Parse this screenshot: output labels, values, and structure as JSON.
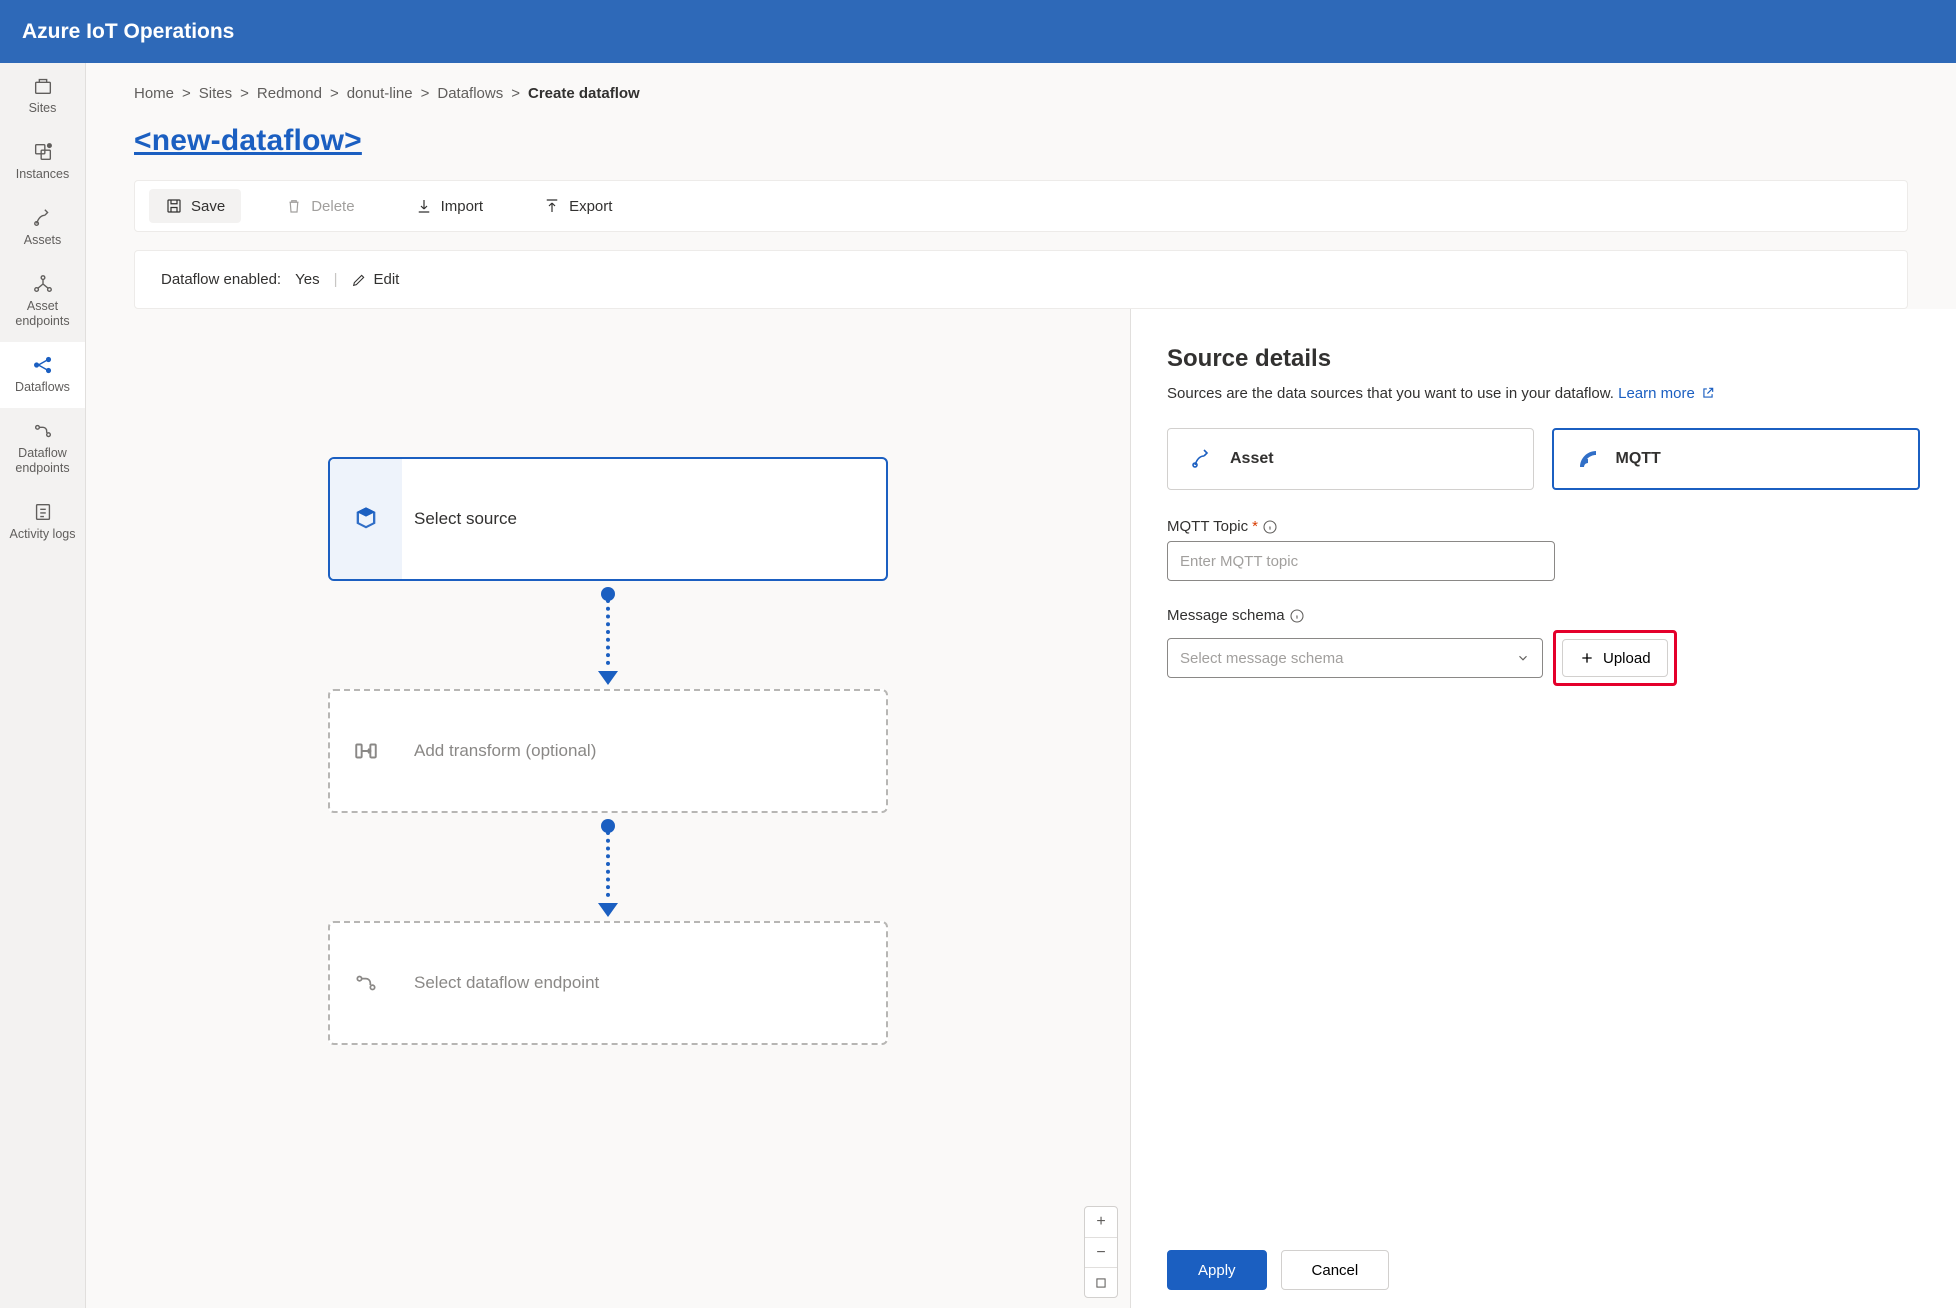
{
  "app": {
    "title": "Azure IoT Operations"
  },
  "sidebar": {
    "items": [
      {
        "label": "Sites"
      },
      {
        "label": "Instances"
      },
      {
        "label": "Assets"
      },
      {
        "label": "Asset endpoints"
      },
      {
        "label": "Dataflows"
      },
      {
        "label": "Dataflow endpoints"
      },
      {
        "label": "Activity logs"
      }
    ]
  },
  "breadcrumb": {
    "items": [
      "Home",
      "Sites",
      "Redmond",
      "donut-line",
      "Dataflows"
    ],
    "current": "Create dataflow"
  },
  "page": {
    "title": "<new-dataflow>"
  },
  "commands": {
    "save": "Save",
    "delete": "Delete",
    "import": "Import",
    "export": "Export"
  },
  "status": {
    "enabled_label": "Dataflow enabled:",
    "enabled_value": "Yes",
    "edit": "Edit"
  },
  "canvas": {
    "source": "Select source",
    "transform": "Add transform (optional)",
    "destination": "Select dataflow endpoint"
  },
  "details": {
    "title": "Source details",
    "desc_prefix": "Sources are the data sources that you want to use in your dataflow. ",
    "learn_more": "Learn more",
    "tabs": {
      "asset": "Asset",
      "mqtt": "MQTT"
    },
    "topic_label": "MQTT Topic",
    "topic_placeholder": "Enter MQTT topic",
    "schema_label": "Message schema",
    "schema_placeholder": "Select message schema",
    "upload": "Upload",
    "apply": "Apply",
    "cancel": "Cancel"
  }
}
